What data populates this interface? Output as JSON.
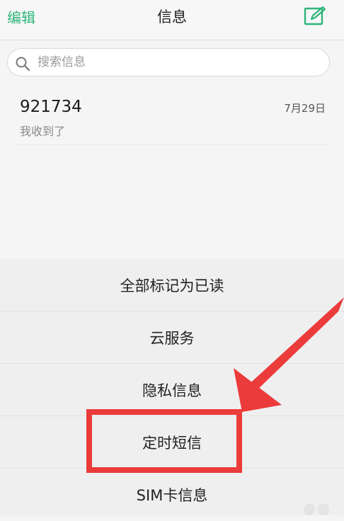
{
  "header": {
    "edit_label": "编辑",
    "title": "信息",
    "compose_icon": "compose-icon"
  },
  "search": {
    "placeholder": "搜索信息"
  },
  "messages": [
    {
      "sender": "921734",
      "preview": "我收到了",
      "date": "7月29日"
    }
  ],
  "menu": {
    "items": [
      {
        "label": "全部标记为已读"
      },
      {
        "label": "云服务"
      },
      {
        "label": "隐私信息"
      },
      {
        "label": "定时短信"
      },
      {
        "label": "SIM卡信息"
      }
    ],
    "highlighted_index": 3
  },
  "colors": {
    "accent": "#2fb57a",
    "annotation": "#ec3b3b"
  }
}
